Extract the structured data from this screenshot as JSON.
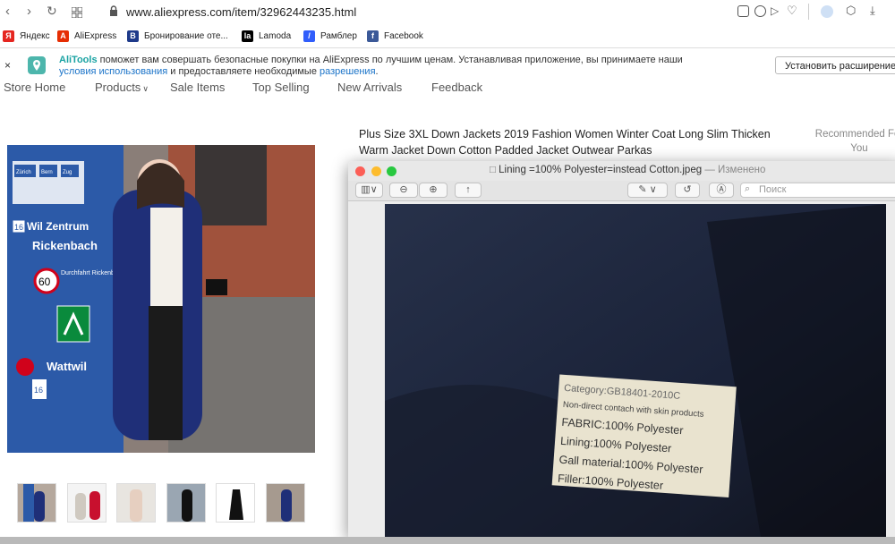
{
  "browser": {
    "url": "www.aliexpress.com/item/32962443235.html",
    "bookmarks": [
      {
        "label": "Яндекс",
        "icon": "yandex-icon",
        "color": "#e52620",
        "glyph": "Я"
      },
      {
        "label": "AliExpress",
        "icon": "aliexpress-icon",
        "color": "#e62e04",
        "glyph": "A"
      },
      {
        "label": "Бронирование оте...",
        "icon": "booking-icon",
        "color": "#1e3a8a",
        "glyph": "B"
      },
      {
        "label": "Lamoda",
        "icon": "lamoda-icon",
        "color": "#000000",
        "glyph": "la"
      },
      {
        "label": "Рамблер",
        "icon": "rambler-icon",
        "color": "#315efb",
        "glyph": "/"
      },
      {
        "label": "Facebook",
        "icon": "facebook-icon",
        "color": "#3b5998",
        "glyph": "f"
      }
    ]
  },
  "banner": {
    "close": "×",
    "brand": "AliTools",
    "line1_rest": " поможет вам совершать безопасные покупки на AliExpress по лучшим ценам. Устанавливая приложение, вы принимаете наши",
    "terms_link": "условия использования",
    "line2_mid": " и предоставляете необходимые ",
    "permissions_link": "разрешения",
    "line2_end": ".",
    "install_button": "Установить расширение"
  },
  "store_nav": [
    "Store Home",
    "Products",
    "Sale Items",
    "Top Selling",
    "New Arrivals",
    "Feedback"
  ],
  "product": {
    "title": "Plus Size 3XL Down Jackets 2019 Fashion Women Winter Coat Long Slim Thicken Warm Jacket Down Cotton Padded Jacket Outwear Parkas",
    "recommended": "Recommended For You"
  },
  "image_signs": {
    "city1": "Zürich",
    "city2": "Bern",
    "city3": "Zug",
    "road16": "16",
    "wil": "Wil Zentrum",
    "rickenbach": "Rickenbach",
    "speed": "60",
    "durch": "Durchfahrt Rickenbach",
    "wattwil": "Wattwil"
  },
  "preview": {
    "filename": "Lining =100% Polyester=instead Cotton.jpeg",
    "status": "— Изменено",
    "search_placeholder": "Поиск"
  },
  "label_tag": {
    "line1": "Category:GB18401-2010C",
    "line2": "Non-direct contach with skin products",
    "line3": "FABRIC:100% Polyester",
    "line4": "Lining:100% Polyester",
    "line5": "Gall material:100% Polyester",
    "line6": "Filler:100% Polyester"
  }
}
